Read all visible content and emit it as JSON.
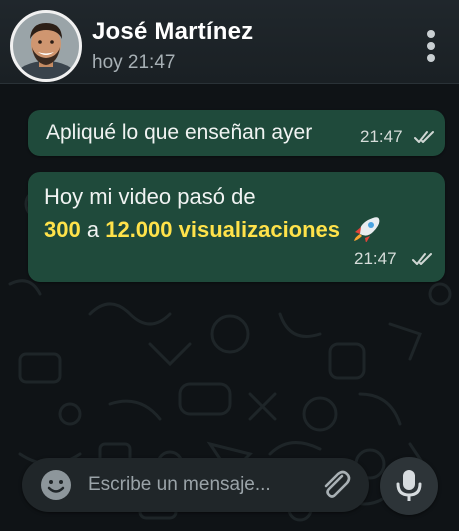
{
  "contact": {
    "name": "José Martínez",
    "status": "hoy 21:47"
  },
  "messages": [
    {
      "text": "Apliqué lo que enseñan ayer",
      "time": "21:47",
      "status_icon": "double-check-icon"
    },
    {
      "line1": "Hoy mi video pasó de",
      "highlight_from": "300",
      "connector": "a",
      "highlight_to": "12.000 visualizaciones",
      "emoji": "rocket-icon",
      "time": "21:47",
      "status_icon": "double-check-icon"
    }
  ],
  "composer": {
    "placeholder": "Escribe un mensaje...",
    "value": ""
  },
  "icons": {
    "menu": "vertical-dots-icon",
    "emoji": "smiley-icon",
    "attach": "paperclip-icon",
    "mic": "microphone-icon"
  },
  "colors": {
    "bubble": "#1f4a3b",
    "highlight": "#ffe24a",
    "header": "#1c2226",
    "wallpaper": "#0f1316"
  }
}
